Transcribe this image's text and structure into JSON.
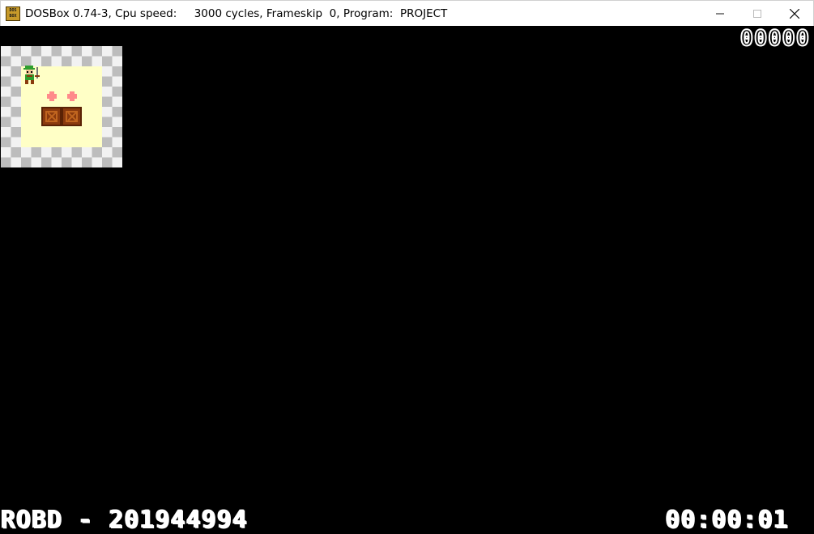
{
  "window": {
    "title": "DOSBox 0.74-3, Cpu speed:     3000 cycles, Frameskip  0, Program:  PROJECT",
    "icon": "dosbox-icon",
    "icon_text": "DOS BOX",
    "controls": [
      "minimize-icon",
      "maximize-icon",
      "close-icon"
    ]
  },
  "game": {
    "score": "00000",
    "player_info": "ROBD - 201944994",
    "timer": "00:00:01",
    "colors": {
      "background": "#000000",
      "floor": "#ffffc6",
      "wall_light": "#f2f2f2",
      "wall_dark": "#bdbdbd",
      "box": "#8a3a0e",
      "goal": "#ff8a8a",
      "player_hat": "#2e9e2e"
    },
    "board": {
      "tiles": [
        "wall",
        "floor",
        "player",
        "goal",
        "box"
      ],
      "goals_count": 2,
      "boxes_count": 2
    }
  }
}
